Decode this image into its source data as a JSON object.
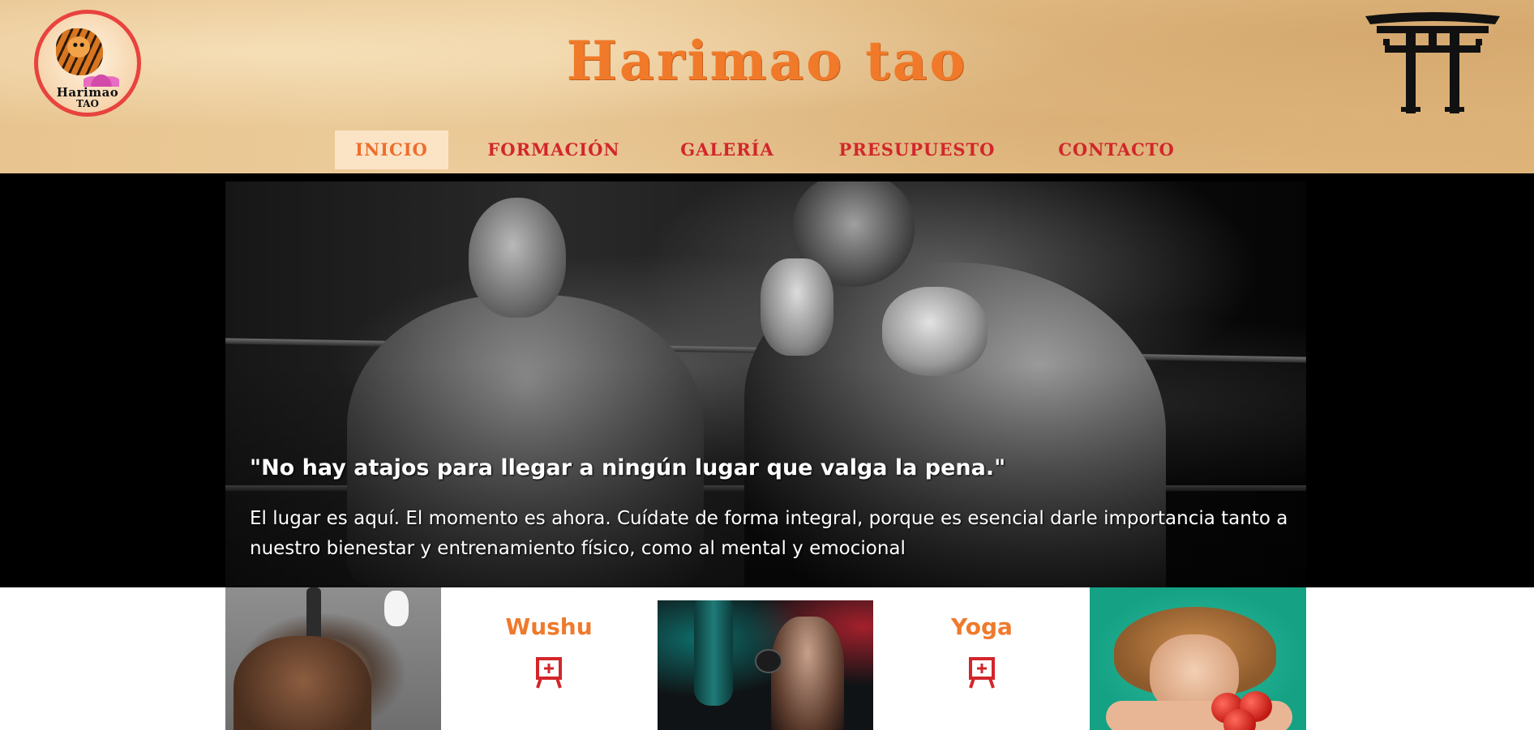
{
  "header": {
    "logo": {
      "line1": "Harimao",
      "line2": "TAO"
    },
    "title": "Harimao tao",
    "nav": [
      {
        "label": "INICIO",
        "active": true
      },
      {
        "label": "FORMACIÓN",
        "active": false
      },
      {
        "label": "GALERÍA",
        "active": false
      },
      {
        "label": "PRESUPUESTO",
        "active": false
      },
      {
        "label": "CONTACTO",
        "active": false
      }
    ],
    "torii_icon": "torii-gate-icon"
  },
  "hero": {
    "quote": "\"No hay atajos para llegar a ningún lugar que valga la pena.\"",
    "text": "El lugar es aquí. El momento es ahora. Cuídate de forma integral, porque es esencial darle importancia tanto a nuestro bienestar y entrenamiento físico, como al mental y emocional"
  },
  "cards": [
    {
      "title": "Wushu",
      "icon": "kanji-icon"
    },
    {
      "title": "Yoga",
      "icon": "kanji-icon"
    }
  ],
  "colors": {
    "title_orange": "#f07a2a",
    "nav_red": "#d2262b",
    "active_tab_bg": "#fbe4c6",
    "card_title_orange": "#ef7a2c",
    "icon_red": "#d2262b"
  }
}
